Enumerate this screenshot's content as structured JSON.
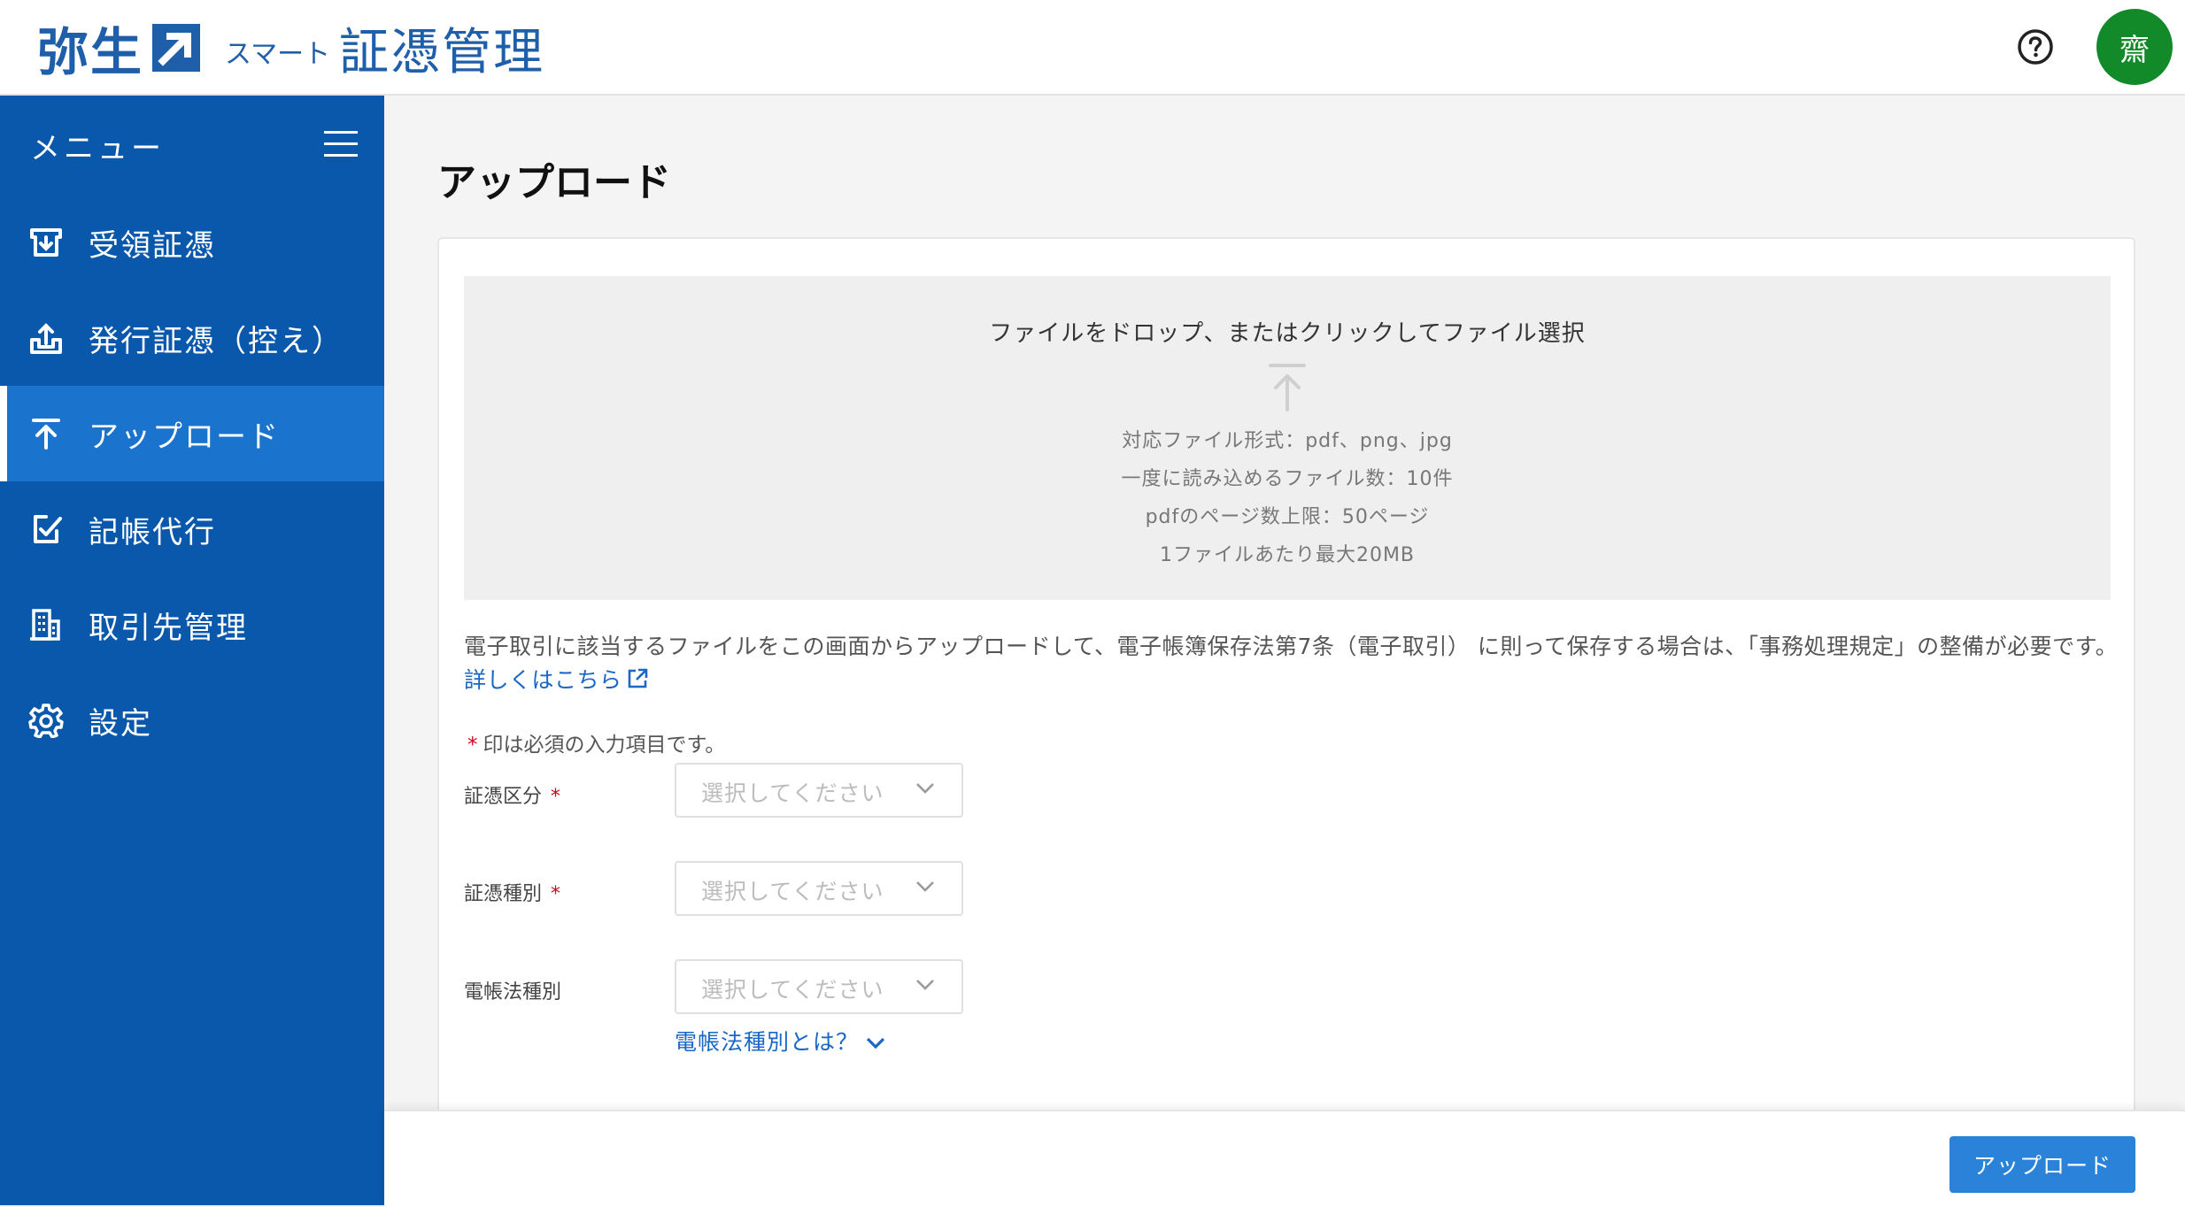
{
  "header": {
    "brand": "弥生",
    "product_small": "スマート",
    "product_big": "証憑管理",
    "help_icon": "question-circle-icon",
    "avatar_text": "齋",
    "colors": {
      "brand": "#1f5faa",
      "avatar_bg": "#138a2a"
    }
  },
  "sidebar": {
    "menu_title": "メニュー",
    "items": [
      {
        "label": "受領証憑",
        "icon": "receive-document-icon",
        "active": false
      },
      {
        "label": "発行証憑（控え）",
        "icon": "issue-document-icon",
        "active": false
      },
      {
        "label": "アップロード",
        "icon": "upload-arrow-icon",
        "active": true
      },
      {
        "label": "記帳代行",
        "icon": "edit-check-icon",
        "active": false
      },
      {
        "label": "取引先管理",
        "icon": "building-icon",
        "active": false
      },
      {
        "label": "設定",
        "icon": "gear-icon",
        "active": false
      }
    ],
    "colors": {
      "bg": "#0a58ab",
      "active_bg": "#1a73cc"
    }
  },
  "main": {
    "title": "アップロード",
    "dropzone": {
      "main_text": "ファイルをドロップ、またはクリックしてファイル選択",
      "lines": [
        "対応ファイル形式：pdf、png、jpg",
        "一度に読み込めるファイル数：10件",
        "pdfのページ数上限：50ページ",
        "1ファイルあたり最大20MB"
      ]
    },
    "notice_text": "電子取引に該当するファイルをこの画面からアップロードして、電子帳簿保存法第7条（電子取引） に則って保存する場合は、「事務処理規定」の整備が必要です。",
    "notice_link": "詳しくはこちら",
    "required_note": "印は必須の入力項目です。",
    "required_mark": "*",
    "fields": [
      {
        "label": "証憑区分",
        "required": true,
        "placeholder": "選択してください"
      },
      {
        "label": "証憑種別",
        "required": true,
        "placeholder": "選択してください"
      },
      {
        "label": "電帳法種別",
        "required": false,
        "placeholder": "選択してください"
      }
    ],
    "help_link": "電帳法種別とは？"
  },
  "footer": {
    "upload_button": "アップロード",
    "colors": {
      "button": "#2b82d9"
    }
  }
}
